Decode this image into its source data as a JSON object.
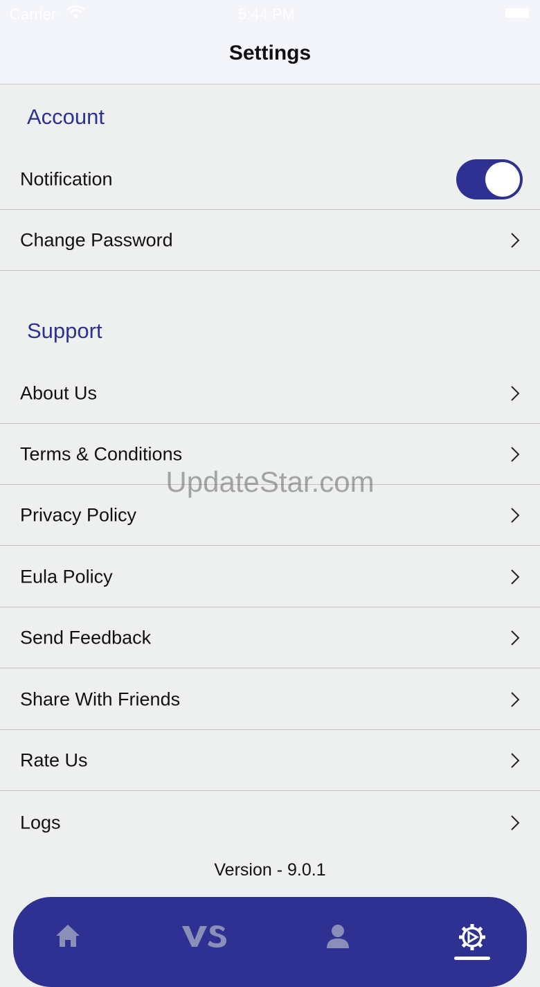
{
  "status_bar": {
    "carrier": "Carrier",
    "time": "5:44 PM"
  },
  "nav": {
    "title": "Settings"
  },
  "sections": {
    "account": {
      "header": "Account",
      "notification_label": "Notification",
      "notification_enabled": true,
      "change_password_label": "Change Password"
    },
    "support": {
      "header": "Support",
      "items": [
        "About Us",
        "Terms & Conditions",
        "Privacy Policy",
        "Eula Policy",
        "Send Feedback",
        "Share With Friends",
        "Rate Us",
        "Logs"
      ]
    }
  },
  "watermark": "UpdateStar.com",
  "version": "Version - 9.0.1",
  "tab_bar": {
    "tabs": [
      {
        "icon": "home-icon"
      },
      {
        "icon": "vs-icon"
      },
      {
        "icon": "profile-icon"
      },
      {
        "icon": "gear-icon",
        "selected": true
      }
    ]
  },
  "colors": {
    "accent": "#2e3192",
    "background": "#eef0f0",
    "header_background": "#f3f5fb",
    "divider": "#c4c4c8"
  }
}
